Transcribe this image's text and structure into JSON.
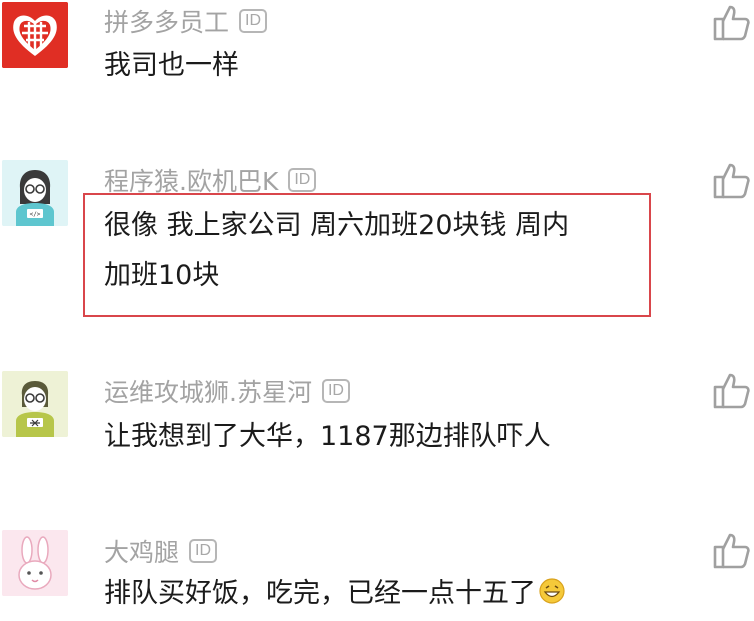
{
  "comments": [
    {
      "username": "拼多多员工",
      "id_badge": "ID",
      "text": "我司也一样",
      "avatar_icon": "pinduoduo-logo-icon",
      "avatar_color": "#e02e24"
    },
    {
      "username": "程序猿.欧机巴K",
      "id_badge": "ID",
      "text_lines": [
        "很像 我上家公司 周六加班20块钱 周内",
        "加班10块"
      ],
      "avatar_icon": "programmer-avatar-icon",
      "avatar_color": "#dff4f6"
    },
    {
      "username": "运维攻城狮.苏星河",
      "id_badge": "ID",
      "text": "让我想到了大华，1187那边排队吓人",
      "avatar_icon": "ops-engineer-avatar-icon",
      "avatar_color": "#eef2d6"
    },
    {
      "username": "大鸡腿",
      "id_badge": "ID",
      "text": "排队买好饭，吃完，已经一点十五了",
      "avatar_icon": "rabbit-avatar-icon",
      "avatar_color": "#fbe7ee",
      "trailing_icon": "grin-emoji-icon"
    }
  ],
  "colors": {
    "highlight": "#d9464b",
    "username": "#a3a3a3",
    "text": "#1b1b1b",
    "like": "#a0a0a0"
  },
  "icons": {
    "like": "thumbs-up-icon"
  }
}
